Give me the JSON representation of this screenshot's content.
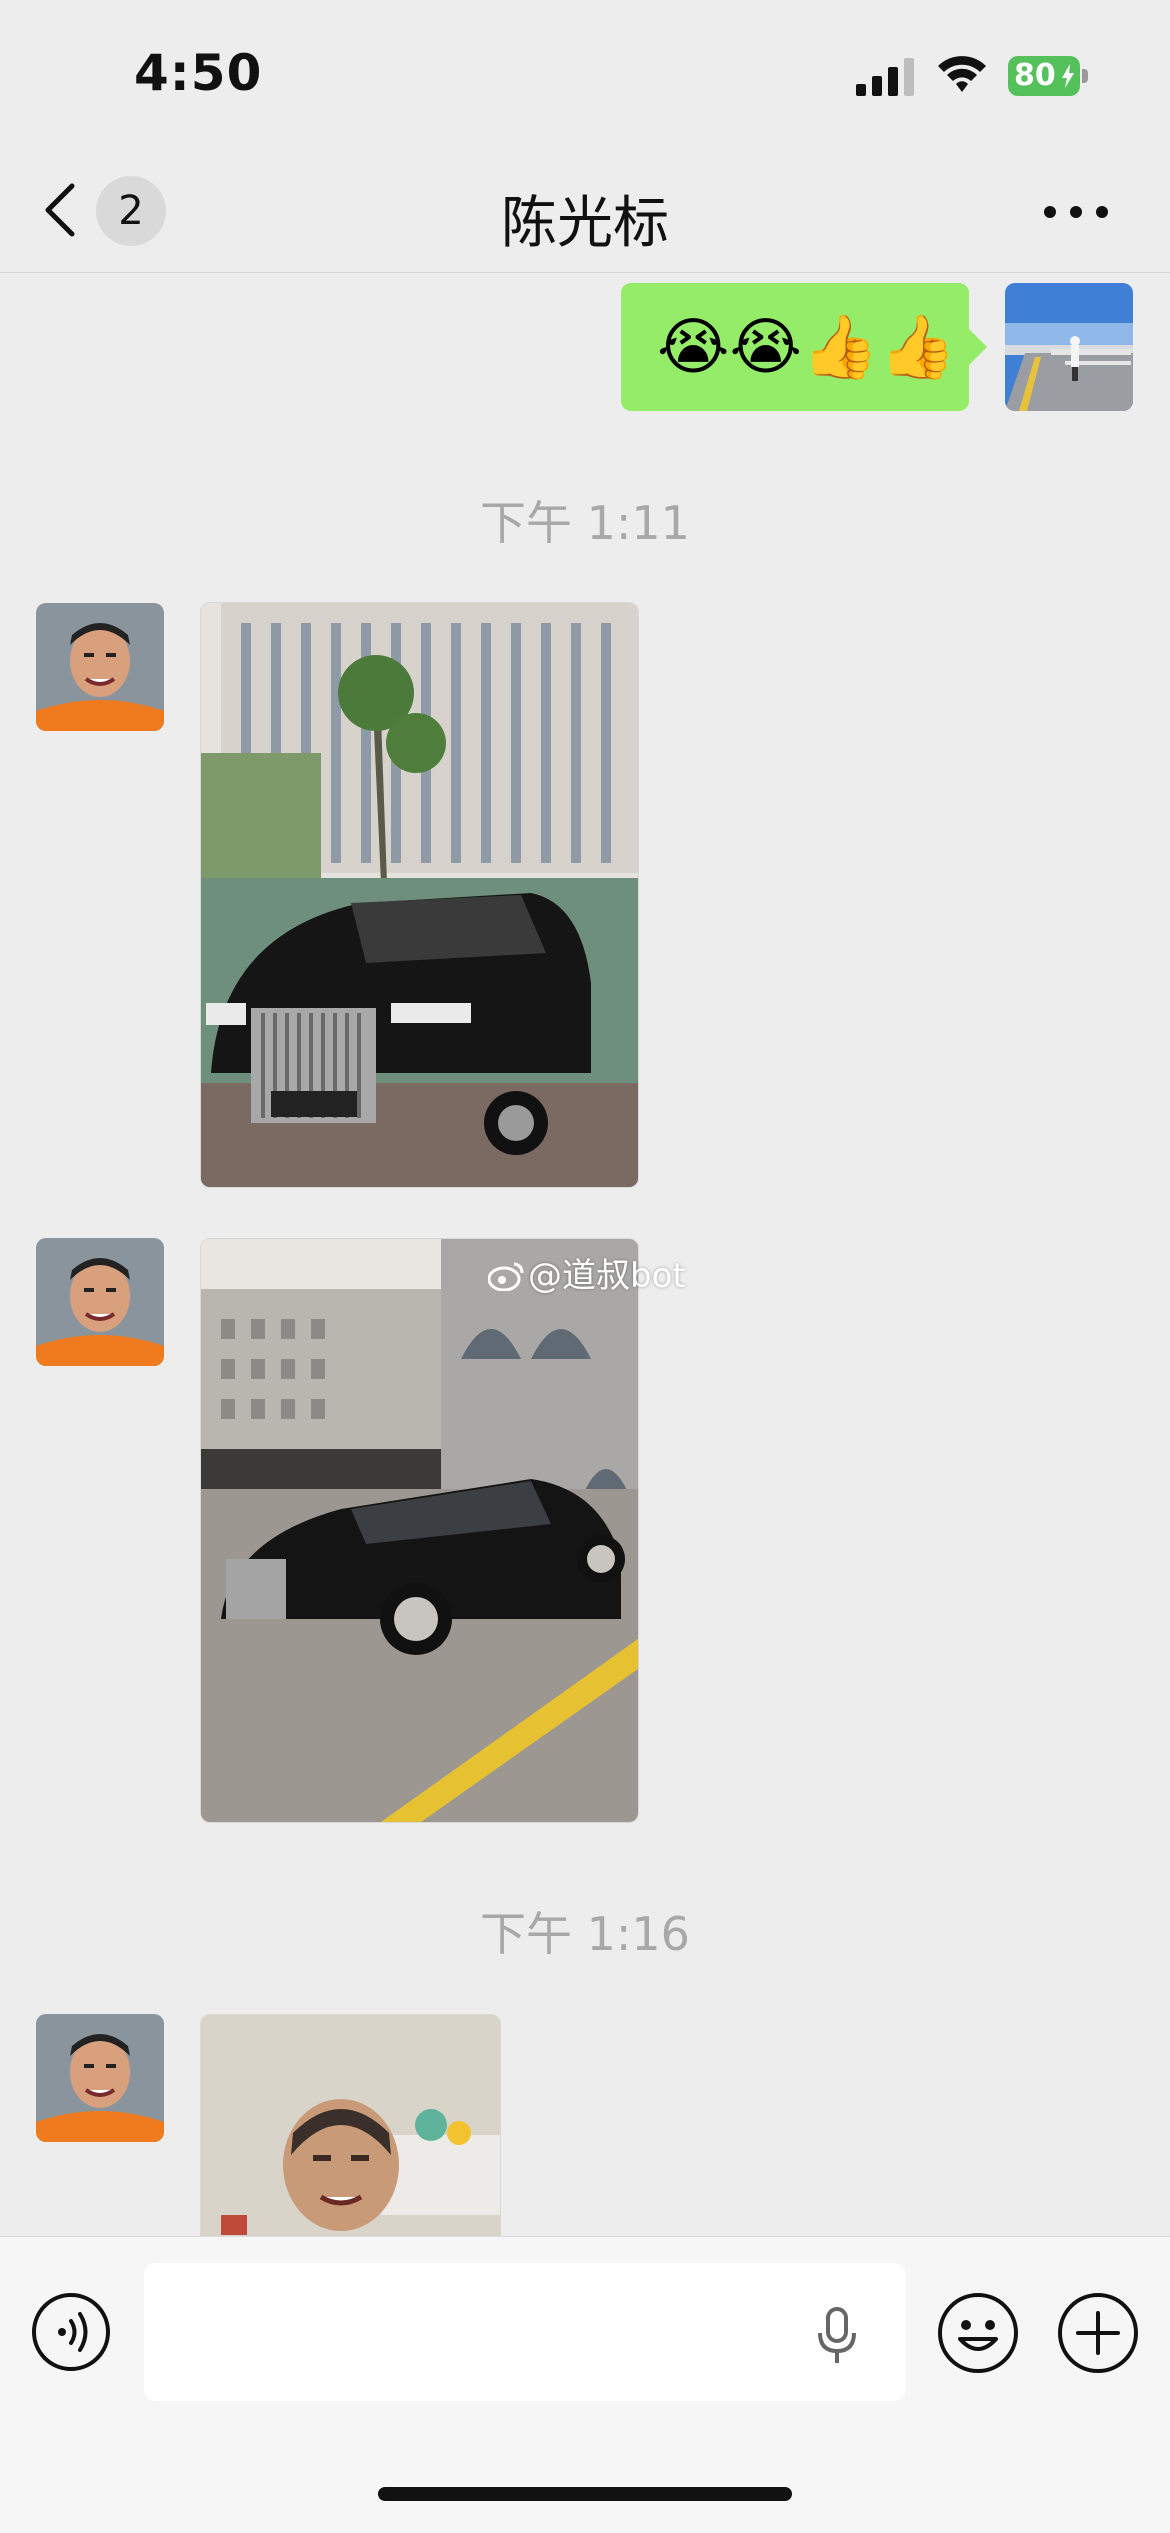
{
  "status_bar": {
    "time": "4:50",
    "battery": "80"
  },
  "nav": {
    "unread_count": "2",
    "title": "陈光标"
  },
  "messages": {
    "sent_emoji": "😭😭👍👍",
    "timestamp_1": "下午 1:11",
    "timestamp_2": "下午 1:16",
    "watermark": "@道叔bot"
  },
  "icons": {
    "back": "chevron-left-icon",
    "more": "more-dots-icon",
    "voice": "voice-input-icon",
    "mic": "microphone-icon",
    "emoji": "emoji-smile-icon",
    "plus": "plus-icon"
  },
  "colors": {
    "background": "#ededed",
    "sent_bubble": "#95ec69",
    "battery": "#55c15a",
    "timestamp": "#a8a8a8"
  }
}
